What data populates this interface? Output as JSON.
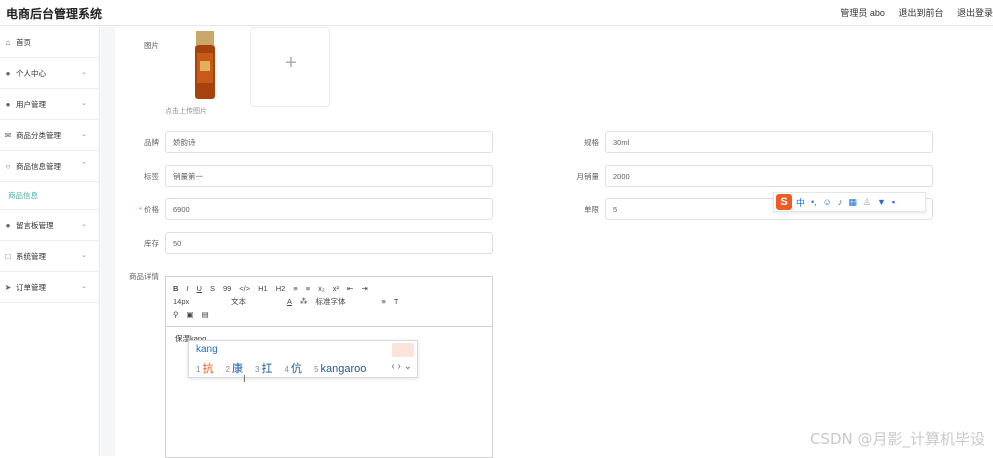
{
  "header": {
    "title": "电商后台管理系统",
    "admin": "管理员 abo",
    "exit_front": "退出到前台",
    "logout": "退出登录"
  },
  "sidebar": {
    "items": [
      {
        "label": "首页",
        "icon": "home-icon"
      },
      {
        "label": "个人中心",
        "icon": "user-icon"
      },
      {
        "label": "用户管理",
        "icon": "location-icon"
      },
      {
        "label": "商品分类管理",
        "icon": "message-icon"
      },
      {
        "label": "商品信息管理",
        "icon": "bulb-icon"
      },
      {
        "label": "商品信息",
        "sub": true
      },
      {
        "label": "留言板管理",
        "icon": "user-icon"
      },
      {
        "label": "系统管理",
        "icon": "menu-icon"
      },
      {
        "label": "订单管理",
        "icon": "send-icon"
      }
    ]
  },
  "form": {
    "image_label": "图片",
    "upload_hint": "点击上传图片",
    "brand_label": "品牌",
    "brand_value": "娇韵诗",
    "spec_label": "规格",
    "spec_value": "30ml",
    "tag_label": "标签",
    "tag_value": "销量第一",
    "monthly_label": "月销量",
    "monthly_value": "2000",
    "price_required": "*",
    "price_label": "价格",
    "price_value": "6900",
    "limit_label": "单限",
    "limit_value": "5",
    "stock_label": "库存",
    "stock_value": "50",
    "detail_label": "商品详情"
  },
  "editor": {
    "row1": [
      "B",
      "I",
      "U",
      "S",
      "99",
      "</>",
      "H1",
      "H2",
      "≡",
      "≡",
      "x₂",
      "x²",
      "⇤",
      "⇥"
    ],
    "font_size": "14px",
    "text_style": "文本",
    "font_family": "标准字体",
    "content": "保湿kang"
  },
  "ime": {
    "pinyin": "kang",
    "candidates": [
      {
        "n": "1",
        "c": "抗"
      },
      {
        "n": "2",
        "c": "康"
      },
      {
        "n": "3",
        "c": "扛"
      },
      {
        "n": "4",
        "c": "伉"
      },
      {
        "n": "5",
        "c": "kangaroo"
      }
    ],
    "nav": "‹ › ⌄"
  },
  "sogou": {
    "logo": "S",
    "mode": "中"
  },
  "watermark": "CSDN @月影_计算机毕设"
}
